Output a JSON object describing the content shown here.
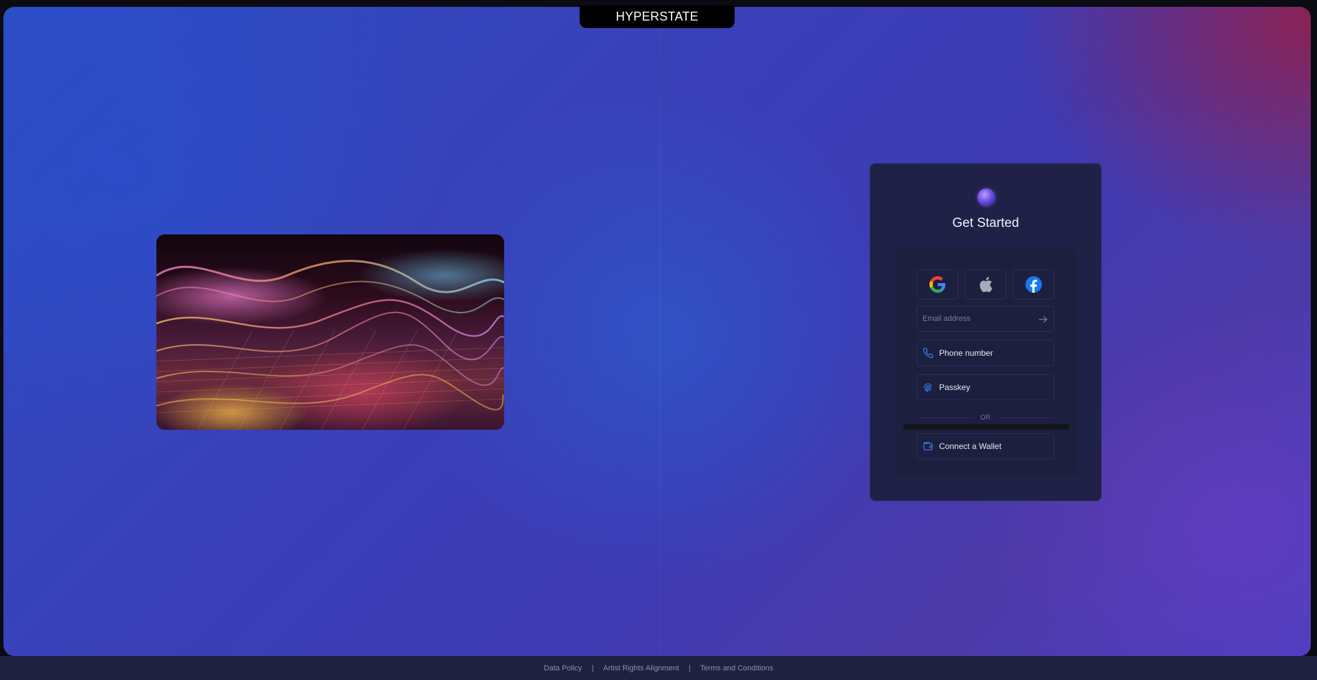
{
  "brand": {
    "title": "HYPERSTATE"
  },
  "card": {
    "title": "Get Started",
    "social_icons": [
      "google-icon",
      "apple-icon",
      "facebook-icon"
    ],
    "email": {
      "placeholder": "Email address",
      "value": ""
    },
    "phone_label": "Phone number",
    "passkey_label": "Passkey",
    "or_label": "OR",
    "wallet_label": "Connect a Wallet"
  },
  "footer": {
    "links": [
      "Data Policy",
      "Artist Rights Alignment",
      "Terms and Conditions"
    ],
    "separator": "|"
  },
  "colors": {
    "accent": "#3b82f6",
    "card_bg": "#1f2147",
    "google_blue": "#4285F4",
    "facebook_blue": "#1877F2"
  }
}
